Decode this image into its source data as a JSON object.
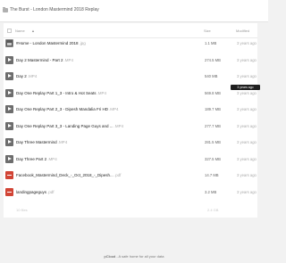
{
  "topbar": {
    "title": "The Burst - London Mastermind 2018 Replay",
    "icon": "folder-icon"
  },
  "columns": {
    "name": "Name",
    "sort_arrow": "▲",
    "size": "Size",
    "modified": "Modified"
  },
  "files": [
    {
      "name": "#Home - London Mastermind 2018",
      "ext": ".jpg",
      "size": "1.1 MB",
      "modified": "3 years ago",
      "type": "image",
      "icon": "image-icon"
    },
    {
      "name": "Day 2 Mastermind - Part 2",
      "ext": ".MP4",
      "size": "274.5 MB",
      "modified": "3 years ago",
      "type": "video",
      "icon": "video-icon"
    },
    {
      "name": "Day 2",
      "ext": ".MP4",
      "size": "540 MB",
      "modified": "3 years ago",
      "type": "video",
      "icon": "video-icon"
    },
    {
      "name": "Day One Replay Part 1_3 - Intro & Hot Seats",
      "ext": ".MP4",
      "size": "569.8 MB",
      "modified": "3 years ago",
      "type": "video",
      "icon": "video-icon"
    },
    {
      "name": "Day One Replay Part 2_3 - Dipesh Mandalia Fri HD",
      "ext": ".MP4",
      "size": "189.7 MB",
      "modified": "3 years ago",
      "type": "video",
      "icon": "video-icon"
    },
    {
      "name": "Day One Replay Part 3_3 - Landing Page Guys and ...",
      "ext": ".MP4",
      "size": "277.7 MB",
      "modified": "3 years ago",
      "type": "video",
      "icon": "video-icon"
    },
    {
      "name": "Day Three Mastermind",
      "ext": ".MP4",
      "size": "281.5 MB",
      "modified": "3 years ago",
      "type": "video",
      "icon": "video-icon"
    },
    {
      "name": "Day Three Part 2",
      "ext": ".MP4",
      "size": "327.5 MB",
      "modified": "3 years ago",
      "type": "video",
      "icon": "video-icon"
    },
    {
      "name": "Facebook_Mastermind_Deck_-_Oct_2018_-_Dipesh...",
      "ext": ".pdf",
      "size": "14.7 MB",
      "modified": "3 years ago",
      "type": "pdf",
      "icon": "pdf-icon"
    },
    {
      "name": "landingpageguys",
      "ext": ".pdf",
      "size": "3.2 MB",
      "modified": "3 years ago",
      "type": "pdf",
      "icon": "pdf-icon"
    }
  ],
  "summary": {
    "count": "10 files",
    "total": "2.4 GB"
  },
  "tooltip": "3 years ago",
  "footer": {
    "brand": "pCloud",
    "tagline": " - A safe home for all your data"
  },
  "colors": {
    "background": "#f2f2f2",
    "panel": "#ffffff",
    "pdf_icon": "#d14435",
    "video_icon": "#6d6d6d"
  }
}
